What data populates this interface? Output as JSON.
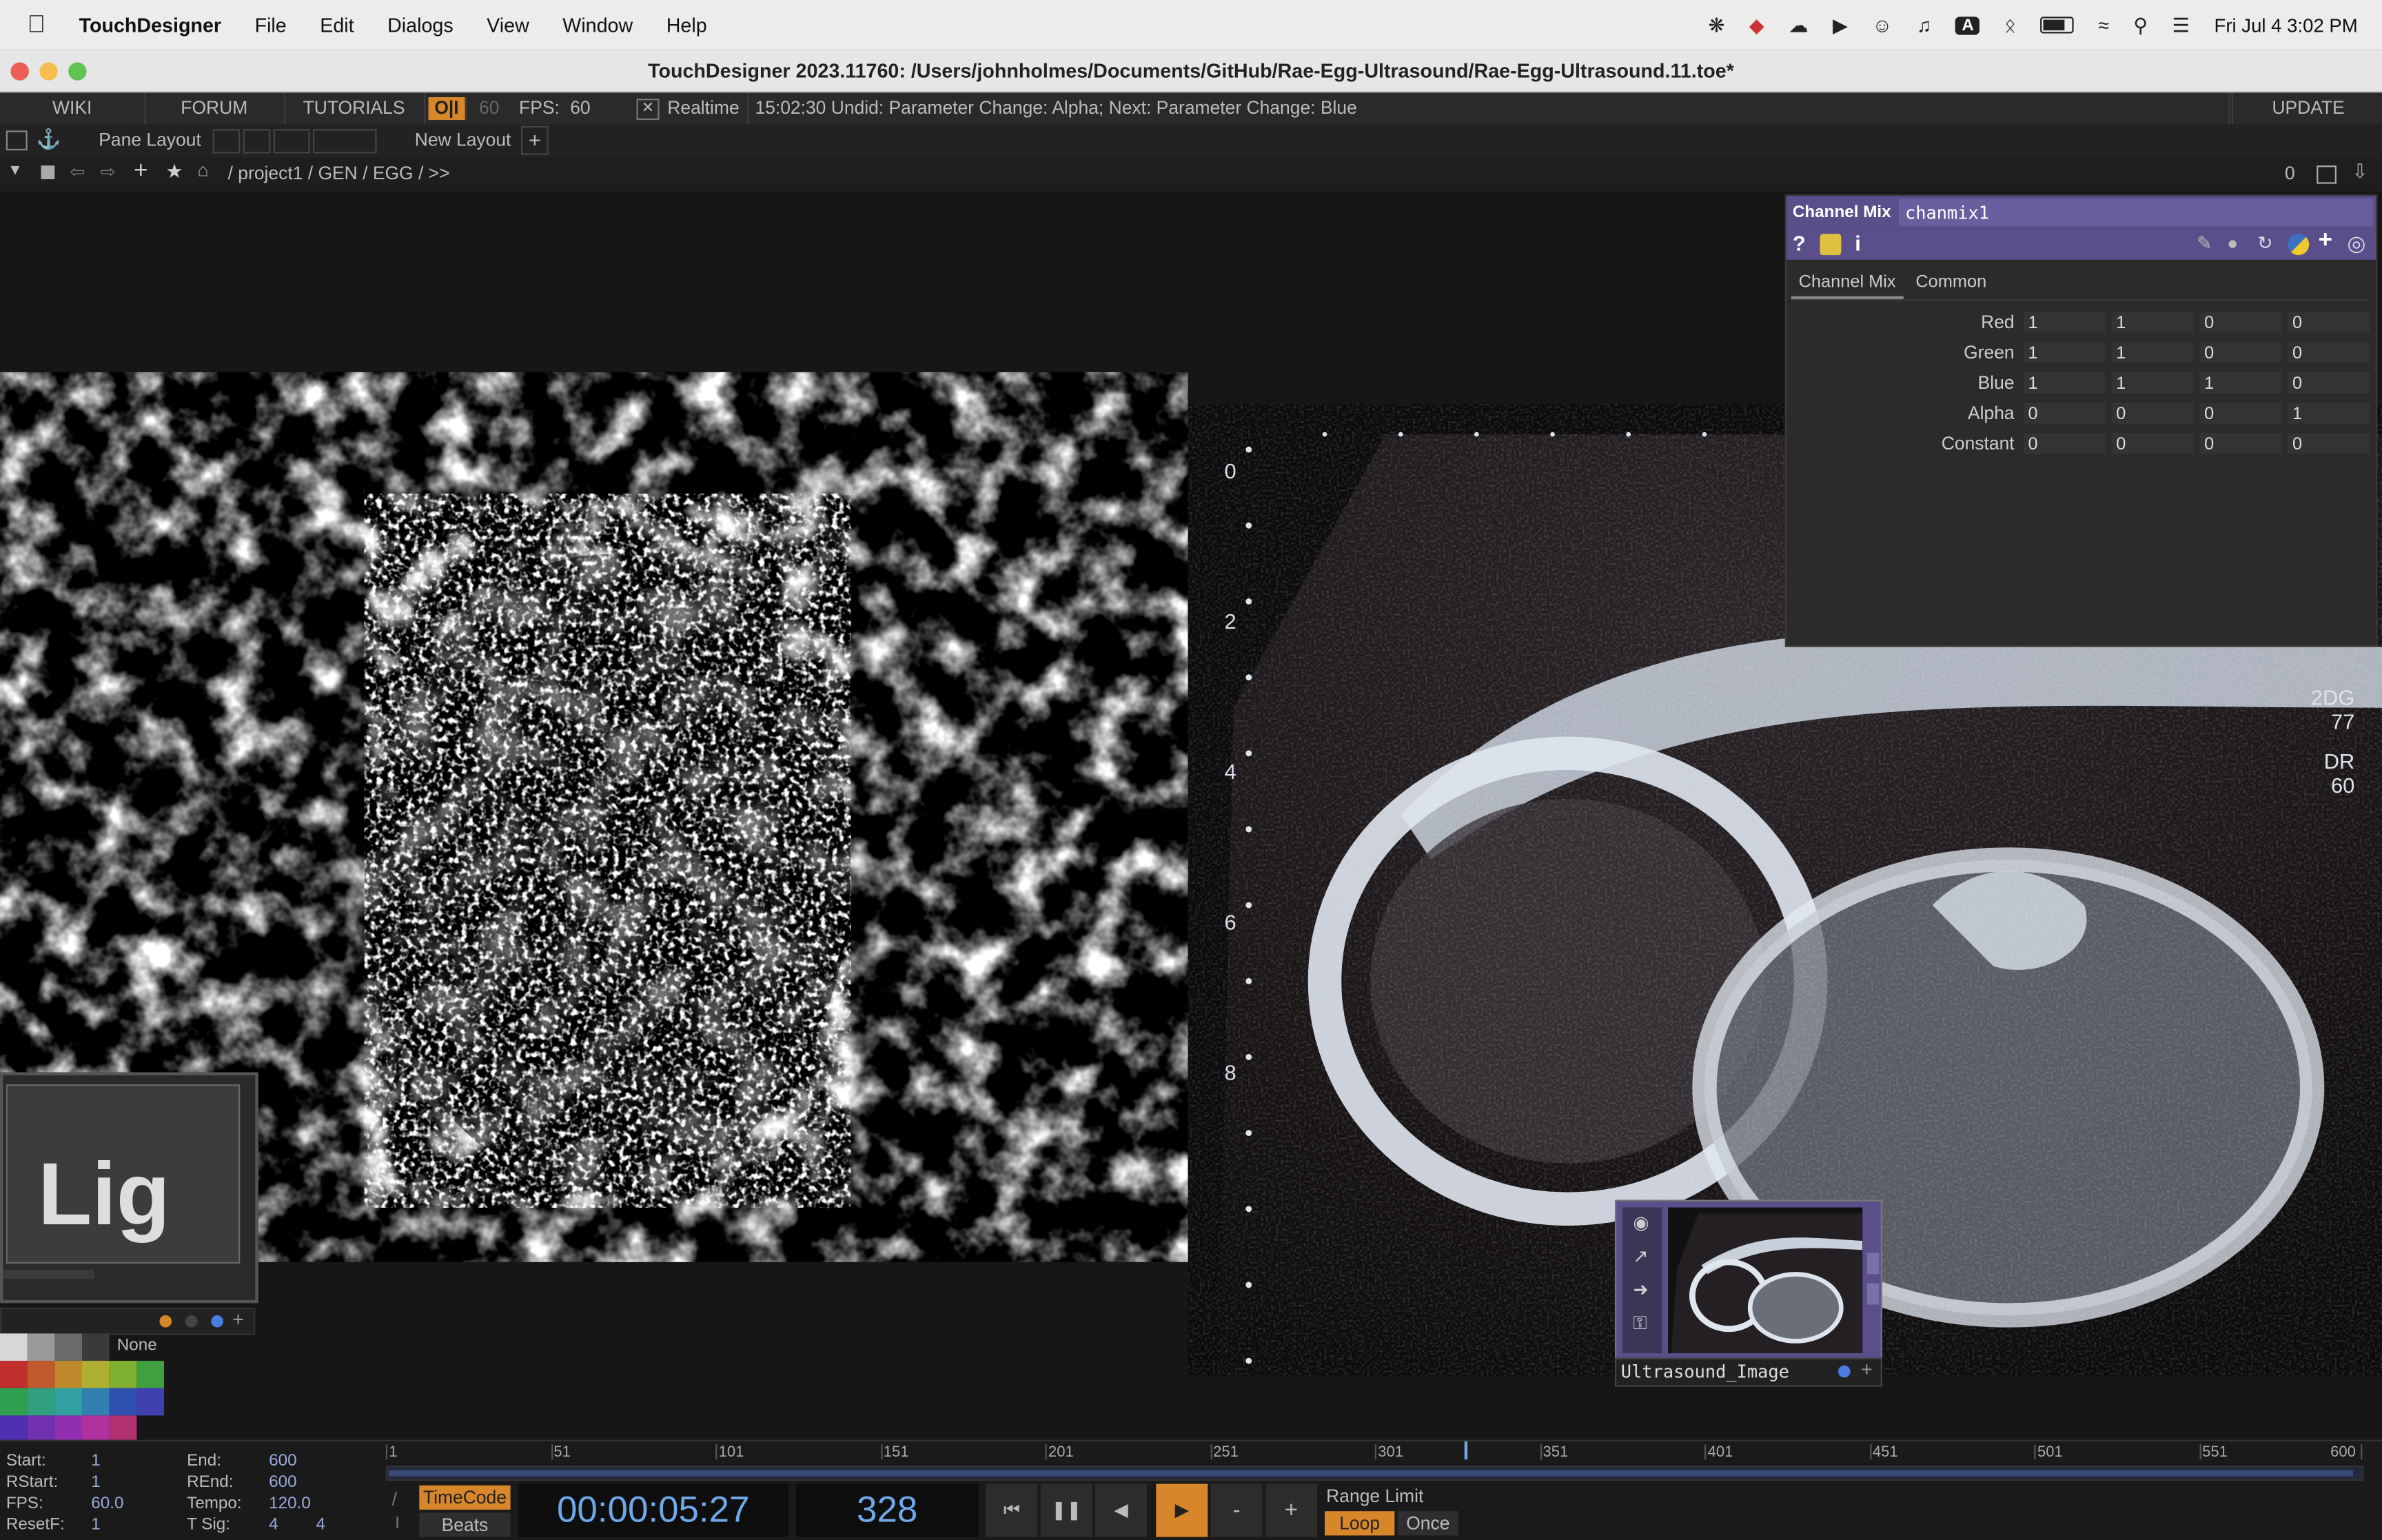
{
  "menubar": {
    "app_name": "TouchDesigner",
    "items": [
      "File",
      "Edit",
      "Dialogs",
      "View",
      "Window",
      "Help"
    ],
    "clock": "Fri Jul 4  3:02 PM",
    "keyboard_badge": "A"
  },
  "window": {
    "title": "TouchDesigner 2023.11760: /Users/johnholmes/Documents/GitHub/Rae-Egg-Ultrasound/Rae-Egg-Ultrasound.11.toe*"
  },
  "toolbar": {
    "wiki": "WIKI",
    "forum": "FORUM",
    "tutorials": "TUTORIALS",
    "oi": "O|I",
    "fps_cap": "60",
    "fps_label": "FPS:",
    "fps_value": "60",
    "realtime_check": "✕",
    "realtime": "Realtime",
    "status": "15:02:30 Undid: Parameter Change: Alpha; Next: Parameter Change: Blue",
    "update": "UPDATE"
  },
  "pane_bar": {
    "pane_layout": "Pane Layout",
    "new_layout": "New Layout",
    "plus": "+"
  },
  "path_bar": {
    "path": "/ project1 / GEN / EGG / >>",
    "zero": "0"
  },
  "param_panel": {
    "op_type": "Channel Mix",
    "op_name": "chanmix1",
    "tabs": [
      "Channel Mix",
      "Common"
    ],
    "rows": [
      {
        "label": "Red",
        "values": [
          "1",
          "1",
          "0",
          "0"
        ]
      },
      {
        "label": "Green",
        "values": [
          "1",
          "1",
          "0",
          "0"
        ]
      },
      {
        "label": "Blue",
        "values": [
          "1",
          "1",
          "1",
          "0"
        ]
      },
      {
        "label": "Alpha",
        "values": [
          "0",
          "0",
          "0",
          "1"
        ]
      },
      {
        "label": "Constant",
        "values": [
          "0",
          "0",
          "0",
          "0"
        ]
      }
    ],
    "toolbar_icons": [
      "help-icon",
      "python-help-icon",
      "info-icon",
      "edit-icon",
      "comment-icon",
      "bypass-icon",
      "python-icon",
      "add-icon",
      "target-icon"
    ]
  },
  "ultrasound": {
    "depth_ticks": [
      "0",
      "2",
      "4",
      "6",
      "8"
    ],
    "readout_1": "2DG",
    "readout_2": "77",
    "readout_3": "DR",
    "readout_4": "60"
  },
  "thumb_node": {
    "name": "Ultrasound_Image"
  },
  "light_node": {
    "text": "Lig"
  },
  "palette": {
    "none_label": "None",
    "swatches": [
      [
        "#d8d8d8",
        "#9a9a9a",
        "#6a6a6a",
        "#3a3a3a"
      ],
      [
        "#c0302c",
        "#c05a2c",
        "#c08a2c",
        "#b0b030",
        "#80b030",
        "#40a040"
      ],
      [
        "#30a050",
        "#30a080",
        "#30a0a0",
        "#3080b0",
        "#3050b0",
        "#4040b0"
      ],
      [
        "#5030b0",
        "#7030b0",
        "#9030b0",
        "#b030a0",
        "#b03070"
      ]
    ]
  },
  "timeline": {
    "ticks": [
      "1",
      "51",
      "101",
      "151",
      "201",
      "251",
      "301",
      "351",
      "401",
      "451",
      "501",
      "551",
      "600"
    ],
    "start_label": "Start:",
    "start": "1",
    "end_label": "End:",
    "end": "600",
    "rstart_label": "RStart:",
    "rstart": "1",
    "rend_label": "REnd:",
    "rend": "600",
    "fps_label": "FPS:",
    "fps": "60.0",
    "tempo_label": "Tempo:",
    "tempo": "120.0",
    "resetf_label": "ResetF:",
    "resetf": "1",
    "tsig_label": "T Sig:",
    "tsig_a": "4",
    "tsig_b": "4",
    "timecode_btn": "TimeCode",
    "beats_btn": "Beats",
    "timecode": "00:00:05:27",
    "frame": "328",
    "minus": "-",
    "plus": "+",
    "range_limit": "Range Limit",
    "loop": "Loop",
    "once": "Once",
    "playhead_frame": 328,
    "range_end": 600
  },
  "colors": {
    "accent_orange": "#d8862a",
    "param_header": "#5a4f8a",
    "timecode_text": "#6fa8e8"
  }
}
